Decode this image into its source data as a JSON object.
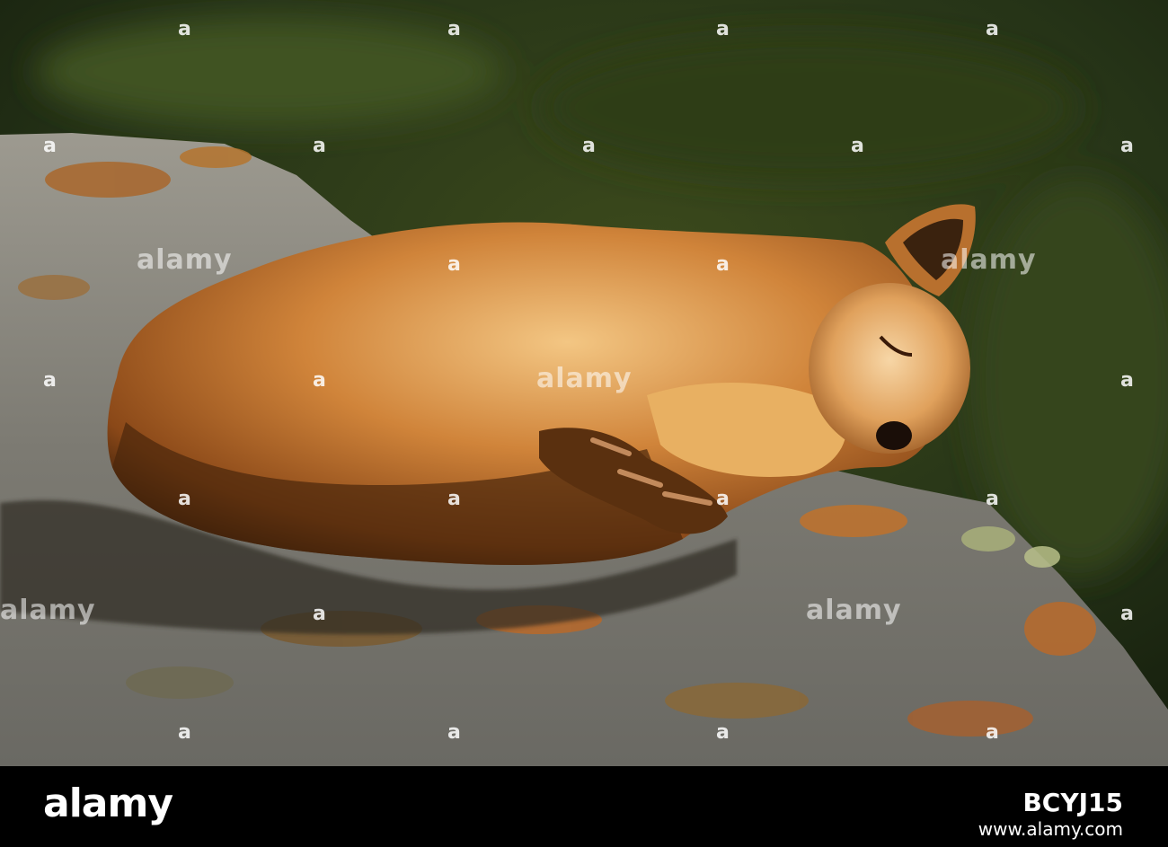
{
  "photo": {
    "subject": "red fox sleeping on a lichen-covered rock",
    "colors": {
      "background_dark": "#1c2a12",
      "background_light": "#3f4d1c",
      "rock": "#8b8a82",
      "lichen": "#b8682a",
      "fur": "#c97a30",
      "fur_highlight": "#f1c07a",
      "shadow": "#2a1a0c"
    }
  },
  "watermark": {
    "mark": "a",
    "word": "alamy"
  },
  "footer": {
    "brand": "alamy",
    "stock_id": "BCYJ15",
    "url": "www.alamy.com"
  }
}
